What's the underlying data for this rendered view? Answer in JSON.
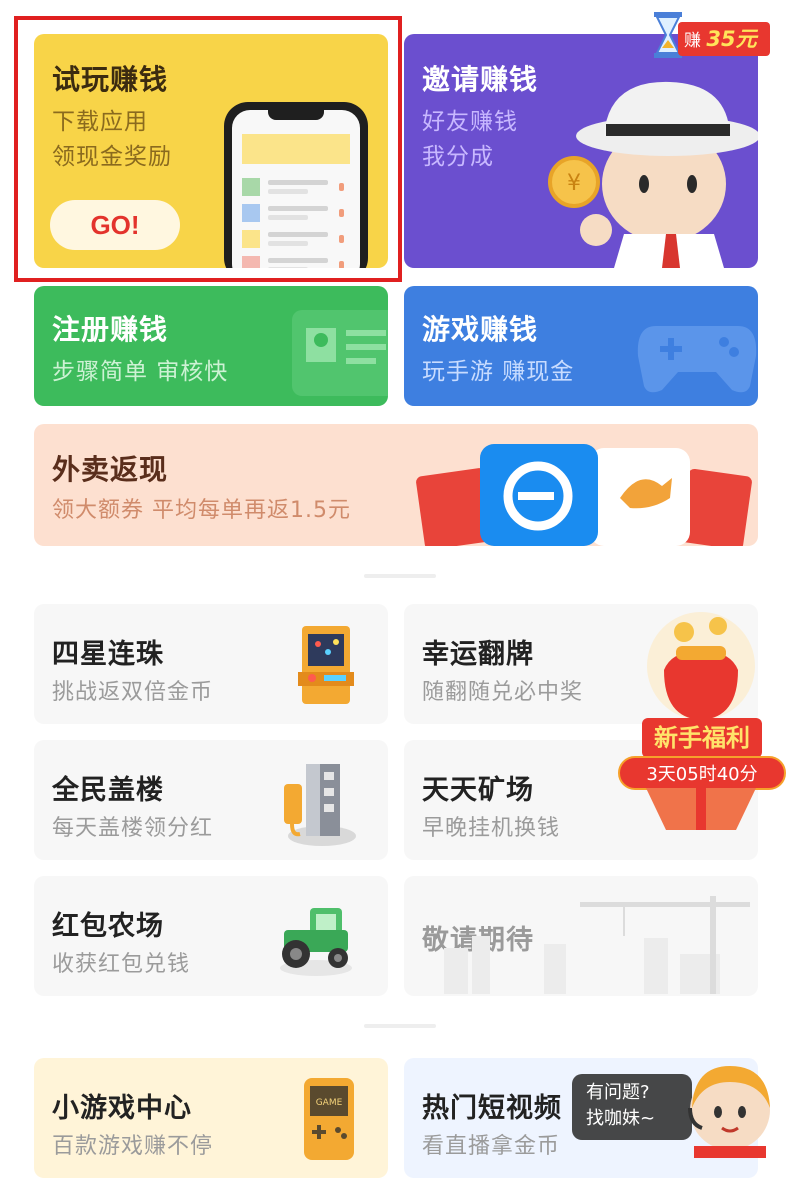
{
  "cards": {
    "try_play": {
      "title": "试玩赚钱",
      "line1": "下载应用",
      "line2": "领现金奖励",
      "button": "GO!"
    },
    "invite": {
      "title": "邀请赚钱",
      "line1": "好友赚钱",
      "line2": "我分成"
    },
    "register": {
      "title": "注册赚钱",
      "subtitle": "步骤简单 审核快"
    },
    "game": {
      "title": "游戏赚钱",
      "subtitle": "玩手游 赚现金"
    },
    "takeout": {
      "title": "外卖返现",
      "subtitle": "领大额券 平均每单再返1.5元"
    }
  },
  "earn_badge": {
    "prefix": "赚",
    "amount": "35元"
  },
  "tiles": {
    "four_stars": {
      "title": "四星连珠",
      "subtitle": "挑战返双倍金币"
    },
    "lucky_flip": {
      "title": "幸运翻牌",
      "subtitle": "随翻随兑必中奖"
    },
    "build": {
      "title": "全民盖楼",
      "subtitle": "每天盖楼领分红"
    },
    "mine": {
      "title": "天天矿场",
      "subtitle": "早晚挂机换钱"
    },
    "farm": {
      "title": "红包农场",
      "subtitle": "收获红包兑钱"
    },
    "coming_soon": {
      "title": "敬请期待"
    },
    "mini_games": {
      "title": "小游戏中心",
      "subtitle": "百款游戏赚不停"
    },
    "short_video": {
      "title": "热门短视频",
      "subtitle": "看直播拿金币"
    }
  },
  "newbie": {
    "title": "新手福利",
    "timer": "3天05时40分"
  },
  "help": {
    "line1": "有问题?",
    "line2": "找咖妹~"
  },
  "colors": {
    "highlight": "#e02020",
    "accent_red": "#e8372f"
  }
}
